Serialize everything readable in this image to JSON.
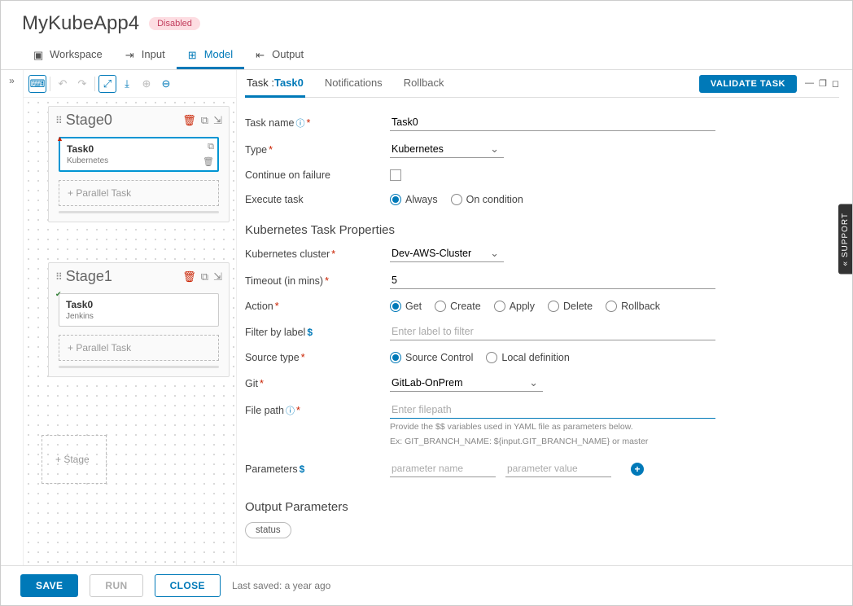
{
  "header": {
    "title": "MyKubeApp4",
    "badge": "Disabled"
  },
  "mainTabs": {
    "workspace": "Workspace",
    "input": "Input",
    "model": "Model",
    "output": "Output"
  },
  "canvas": {
    "stages": [
      {
        "title": "Stage0",
        "task": {
          "name": "Task0",
          "type": "Kubernetes"
        }
      },
      {
        "title": "Stage1",
        "task": {
          "name": "Task0",
          "type": "Jenkins"
        }
      }
    ],
    "parallelTask": "+ Parallel Task",
    "addStage": "+ Stage"
  },
  "subTabs": {
    "task": "Task :",
    "taskName": "Task0",
    "notifications": "Notifications",
    "rollback": "Rollback"
  },
  "validate": "VALIDATE TASK",
  "form": {
    "labels": {
      "taskName": "Task name",
      "type": "Type",
      "continueOnFailure": "Continue on failure",
      "executeTask": "Execute task",
      "kubeProps": "Kubernetes Task Properties",
      "cluster": "Kubernetes cluster",
      "timeout": "Timeout (in mins)",
      "action": "Action",
      "filterByLabel": "Filter by label",
      "sourceType": "Source type",
      "git": "Git",
      "filePath": "File path",
      "parameters": "Parameters",
      "outputParams": "Output Parameters"
    },
    "values": {
      "taskName": "Task0",
      "type": "Kubernetes",
      "cluster": "Dev-AWS-Cluster",
      "timeout": "5",
      "git": "GitLab-OnPrem"
    },
    "placeholders": {
      "filterByLabel": "Enter label to filter",
      "filePath": "Enter filepath",
      "paramName": "parameter name",
      "paramValue": "parameter value"
    },
    "radios": {
      "execute": {
        "always": "Always",
        "onCondition": "On condition"
      },
      "action": {
        "get": "Get",
        "create": "Create",
        "apply": "Apply",
        "delete": "Delete",
        "rollback": "Rollback"
      },
      "sourceType": {
        "sourceControl": "Source Control",
        "localDef": "Local definition"
      }
    },
    "hint1": "Provide the $$ variables used in YAML file as parameters below.",
    "hint2": "Ex: GIT_BRANCH_NAME: ${input.GIT_BRANCH_NAME} or master",
    "outputChip": "status"
  },
  "footer": {
    "save": "SAVE",
    "run": "RUN",
    "close": "CLOSE",
    "lastSaved": "Last saved: a year ago"
  },
  "support": "SUPPORT"
}
